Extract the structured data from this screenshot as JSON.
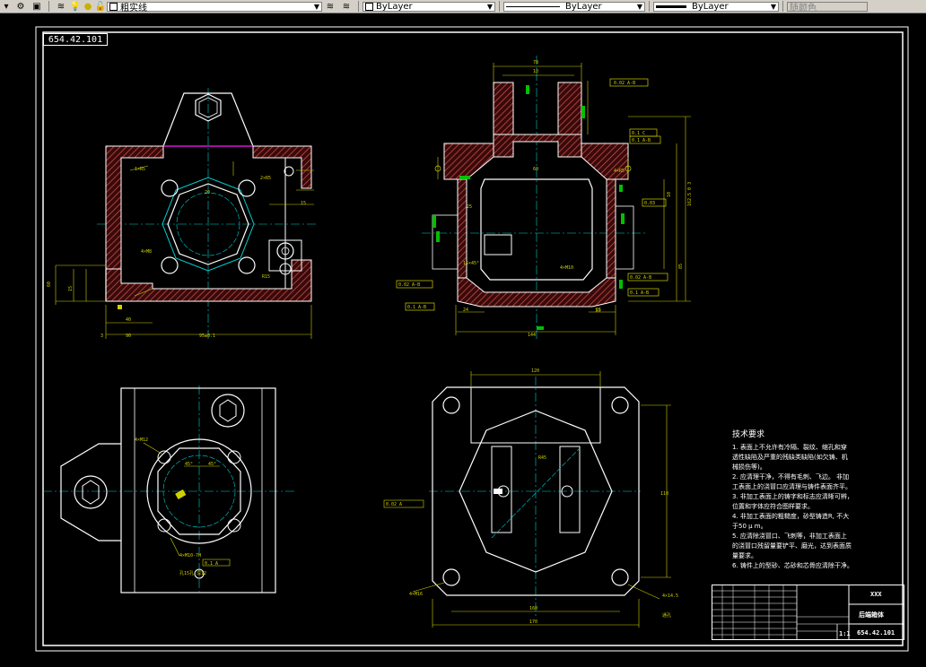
{
  "toolbar": {
    "layer_name": "粗实线",
    "color_value": "ByLayer",
    "linetype_value": "ByLayer",
    "lineweight_value": "ByLayer",
    "plotstyle_value": "随颜色"
  },
  "drawing": {
    "ref_number": "654.42.101",
    "notes_title": "技术要求",
    "notes": [
      "1. 表面上不允许有冷隔、裂纹、缩孔和穿",
      "透性缺陷及严重的残缺类缺陷(如欠铸、机",
      "械损伤等)。",
      "2. 应清理干净，不得有毛刺、飞边。 非加",
      "工表面上的浇冒口应清理与铸件表面齐平。",
      "3. 非加工表面上的铸字和标志应清晰可辨，",
      "位置和字体应符合图样要求。",
      "4. 非加工表面的粗糙度，砂型铸造R, 不大",
      "于50 μ m。",
      "5. 应清除浇冒口、飞刺等，非加工表面上",
      "的浇冒口残留量要铲平、磨光，达到表面质",
      "量要求。",
      "6. 铸件上的型砂、芯砂和芯骨应清除干净。"
    ],
    "title_block": {
      "company": "XXX",
      "part_name": "后端箱体",
      "scale": "1:1",
      "drawing_no": "654.42.101"
    }
  }
}
